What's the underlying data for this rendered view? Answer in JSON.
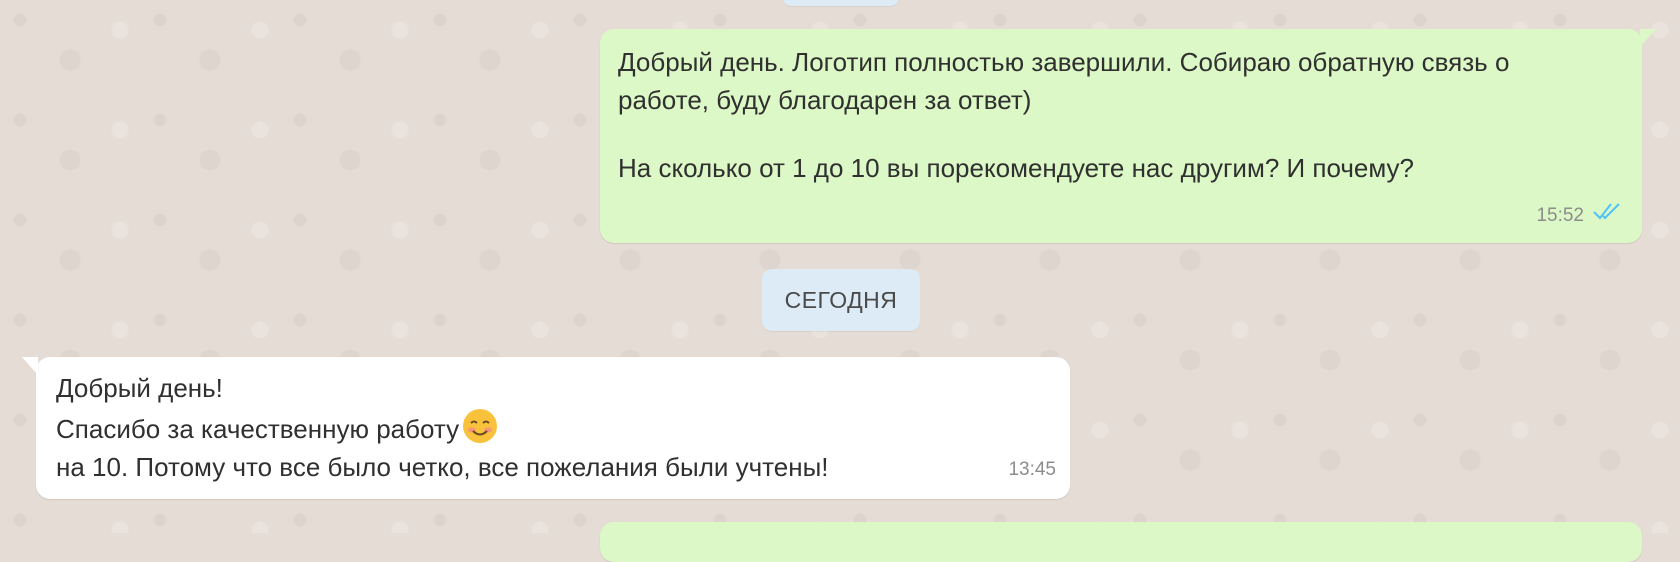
{
  "messages": {
    "outgoing": {
      "line1": "Добрый день. Логотип полностью завершили. Собираю обратную связь о",
      "line2": "работе, буду благодарен за ответ)",
      "line3": "На сколько от 1 до 10 вы порекомендуете нас другим? И почему?",
      "time": "15:52",
      "status_icon": "double-check-read-icon"
    },
    "date_separator": "СЕГОДНЯ",
    "incoming": {
      "line1": "Добрый день!",
      "line2": "Спасибо за качественную работу",
      "emoji_icon": "smiling-face-emoji-icon",
      "line3": "на 10. Потому что все было четко, все пожелания были учтены!",
      "time": "13:45"
    }
  },
  "colors": {
    "chat_background": "#e5ddd5",
    "outgoing_bubble": "#dcf8c6",
    "incoming_bubble": "#ffffff",
    "date_pill": "#dcebf5",
    "read_ticks": "#4fc3f7"
  }
}
